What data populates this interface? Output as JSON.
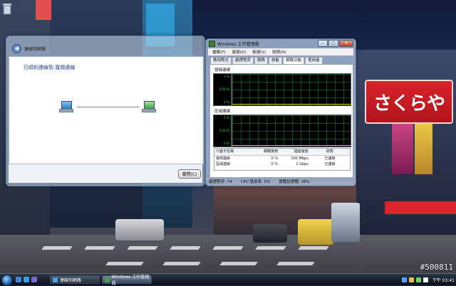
{
  "dialog": {
    "title": "連線到網路",
    "message": "已順利連線到 寬頻連線",
    "close_button": "關閉(C)"
  },
  "taskmgr": {
    "title": "Windows 工作管理員",
    "menu": [
      "檔案(F)",
      "選項(O)",
      "檢視(V)",
      "說明(H)"
    ],
    "tabs": [
      "應用程式",
      "處理程序",
      "服務",
      "效能",
      "網路功能",
      "使用者"
    ],
    "active_tab": "網路功能",
    "section1": "寬頻連線",
    "section2": "區域連線",
    "graph_ticks": [
      "1 %",
      "0.50 %",
      "0 %"
    ],
    "adapter_headers": [
      "介面卡名稱",
      "網路使用",
      "連結速度",
      "狀態"
    ],
    "adapter_rows": [
      [
        "寬頻連線",
        "0 %",
        "100 Mbps",
        "已連線"
      ],
      [
        "區域連線",
        "0 %",
        "1 Gbps",
        "已連線"
      ]
    ],
    "status": {
      "processes": "處理程序: 74",
      "cpu": "CPU 使用率: 0%",
      "memory": "實體記憶體: 38%"
    }
  },
  "taskbar": {
    "tasks": [
      {
        "label": "連線到網路",
        "icon_color": "#49a0e6"
      },
      {
        "label": "Windows 工作管理員",
        "icon_color": "#4a9a4a"
      }
    ],
    "clock": "下午 03:41",
    "tray_colors": [
      "#5aa0ff",
      "#e0c14a",
      "#6fd36f",
      "#ffffff"
    ]
  },
  "wallpaper": {
    "sign_text": "さくらや",
    "watermark": "#500811"
  },
  "colors": {
    "graph_grid": "#00823c",
    "graph_line": "#d8d800",
    "link_text": "#1a3b8a"
  }
}
